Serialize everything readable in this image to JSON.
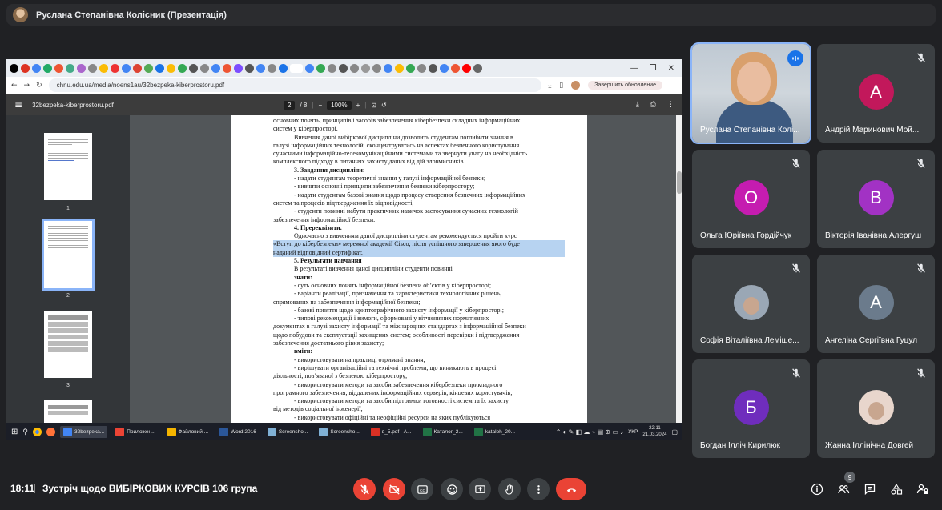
{
  "presenter_bar": {
    "title": "Руслана Степанівна Колісник (Презентація)"
  },
  "browser": {
    "url": "chnu.edu.ua/media/noens1au/32bezpeka-kiberprostoru.pdf",
    "update_label": "Завершить обновление",
    "window_controls": [
      "—",
      "❐",
      "✕"
    ]
  },
  "pdf": {
    "file_name": "32bezpeka-kiberprostoru.pdf",
    "page_current": "2",
    "page_total": "/ 8",
    "zoom": "100%",
    "thumbnails": [
      "1",
      "2",
      "3"
    ],
    "lines": [
      {
        "text": "основних понять, принципів і засобів забезпечення кібербезпеки складних інформаційних",
        "cls": ""
      },
      {
        "text": "систем у кіберпросторі.",
        "cls": ""
      },
      {
        "text": "Вивчення даної вибіркової  дисципліни дозволить студентам поглибити знання в",
        "cls": "ind"
      },
      {
        "text": "галузі інформаційних технологій, сконцентруватись на аспектах безпечного користування",
        "cls": ""
      },
      {
        "text": "сучасними інформаційно-телекомунікаційними системами та звернути увагу на необхідність",
        "cls": ""
      },
      {
        "text": "комплексного підходу в питаннях захисту даних від дій зловмисників.",
        "cls": ""
      },
      {
        "text": "3. Завдання дисципліни:",
        "cls": "hd"
      },
      {
        "text": "- надати студентам теоретичні знання у галузі інформаційної безпеки;",
        "cls": "ind"
      },
      {
        "text": "- вивчити основні принципи забезпечення безпеки кіберпростору;",
        "cls": "ind"
      },
      {
        "text": "- надати студентам базові знання щодо процесу створення безпечних інформаційних",
        "cls": "ind"
      },
      {
        "text": "систем та процесів підтвердження їх відповідності;",
        "cls": ""
      },
      {
        "text": "- студенти повинні набути практичних навичок застосування сучасних технологій",
        "cls": "ind"
      },
      {
        "text": "забезпечення інформаційної безпеки.",
        "cls": ""
      },
      {
        "text": "4. Пререквізити.",
        "cls": "hd"
      },
      {
        "text": "Одночасно з вивченням даної дисципліни студентам рекомендується пройти курс",
        "cls": "ind"
      },
      {
        "text": "«Вступ до кібербезпеки» мережної академії Cisco, після успішного завершення якого буде",
        "cls": "hl"
      },
      {
        "text": "наданий відповідний сертифікат.",
        "cls": "hl"
      },
      {
        "text": "5. Результати навчання",
        "cls": "hd"
      },
      {
        "text": "В результаті вивчення даної дисципліни студенти повинні",
        "cls": "ind"
      },
      {
        "text": "знати:",
        "cls": "hd"
      },
      {
        "text": "-              суть основних понять інформаційної безпеки об’єктів у кіберпросторі;",
        "cls": "ind"
      },
      {
        "text": "-              варіанти реалізації, призначення та характеристики технологічних рішень,",
        "cls": "ind"
      },
      {
        "text": "спрямованих на забезпечення інформаційної безпеки;",
        "cls": ""
      },
      {
        "text": "-              базові поняття щодо криптографічного захисту інформації у кіберпросторі;",
        "cls": "ind"
      },
      {
        "text": "-              типові рекомендації і вимоги, сформовані у вітчизняних нормативних",
        "cls": "ind"
      },
      {
        "text": "документах в галузі захисту інформації та міжнародних стандартах з інформаційної безпеки",
        "cls": ""
      },
      {
        "text": "щодо побудови та експлуатації захищених систем; особливості перевірки і підтвердження",
        "cls": ""
      },
      {
        "text": "забезпечення достатнього рівня захисту;",
        "cls": ""
      },
      {
        "text": "вміти:",
        "cls": "hd"
      },
      {
        "text": "-              використовувати на практиці отримані знання;",
        "cls": "ind"
      },
      {
        "text": "-              вирішувати організаційні та технічні проблеми, що виникають в процесі",
        "cls": "ind"
      },
      {
        "text": "діяльності, пов’язаної з безпекою кіберпростору;",
        "cls": ""
      },
      {
        "text": "-              використовувати методи та засоби забезпечення кібербезпеки прикладного",
        "cls": "ind"
      },
      {
        "text": "програмного забезпечення, віддалених інформаційних серверів, кінцевих користувачів;",
        "cls": ""
      },
      {
        "text": "-              використовувати методи та засоби підтримки готовності систем та їх захисту",
        "cls": "ind"
      },
      {
        "text": "від методів соціальної інженерії;",
        "cls": ""
      },
      {
        "text": "-              використовувати офіційні та неофіційні ресурси на яких публікуються",
        "cls": "ind"
      }
    ]
  },
  "taskbar": {
    "items": [
      {
        "label": "32bezpeka...",
        "color": "#4285f4",
        "active": true
      },
      {
        "label": "Приложен...",
        "color": "#ea4335",
        "active": false
      },
      {
        "label": "Файловий ...",
        "color": "#f4b400",
        "active": false
      },
      {
        "label": "Word 2016",
        "color": "#2b579a",
        "active": false
      },
      {
        "label": "Screensho...",
        "color": "#7fb0d6",
        "active": false
      },
      {
        "label": "Screensho...",
        "color": "#7fb0d6",
        "active": false
      },
      {
        "label": "в_5.pdf - A...",
        "color": "#d93025",
        "active": false
      },
      {
        "label": "Каталог_2...",
        "color": "#217346",
        "active": false
      },
      {
        "label": "kataloh_20...",
        "color": "#217346",
        "active": false
      }
    ],
    "lang": "УКР",
    "time": "22:11",
    "date": "21.03.2024"
  },
  "participants": [
    {
      "name": "Руслана Степанівна Колі...",
      "initial": "",
      "color": "",
      "type": "video",
      "speaking": true,
      "muted": false
    },
    {
      "name": "Андрій Маринович Мой...",
      "initial": "А",
      "color": "#c2185b",
      "type": "initial",
      "speaking": false,
      "muted": true
    },
    {
      "name": "Ольга Юріївна Гордійчук",
      "initial": "О",
      "color": "#c51cb0",
      "type": "initial",
      "speaking": false,
      "muted": true
    },
    {
      "name": "Вікторія Іванівна Алергуш",
      "initial": "В",
      "color": "#a232c4",
      "type": "initial",
      "speaking": false,
      "muted": true
    },
    {
      "name": "Софія Віталіївна Леміше...",
      "initial": "",
      "color": "#9aa7b5",
      "type": "photo",
      "speaking": false,
      "muted": true
    },
    {
      "name": "Ангеліна Сергіївна Гуцул",
      "initial": "А",
      "color": "#6b7b8c",
      "type": "initial",
      "speaking": false,
      "muted": true
    },
    {
      "name": "Богдан Ілліч Кирилюк",
      "initial": "Б",
      "color": "#6f2dbd",
      "type": "initial",
      "speaking": false,
      "muted": true
    },
    {
      "name": "Жанна Іллінічна Довгей",
      "initial": "",
      "color": "#e8d6cc",
      "type": "photo",
      "speaking": false,
      "muted": true
    }
  ],
  "meeting": {
    "time": "18:11",
    "name": "Зустріч щодо ВИБІРКОВИХ КУРСІВ 106 група",
    "people_count": "9"
  }
}
